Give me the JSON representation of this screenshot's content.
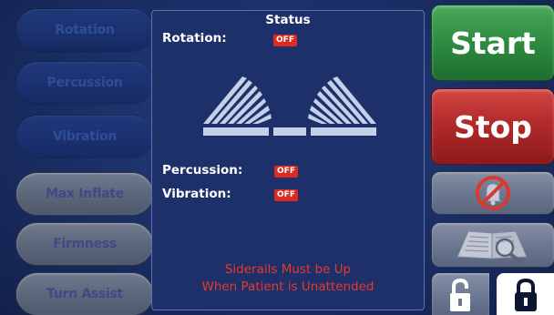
{
  "left_buttons": [
    {
      "label": "Rotation"
    },
    {
      "label": "Percussion"
    },
    {
      "label": "Vibration"
    },
    {
      "label": "Max Inflate"
    },
    {
      "label": "Firmness"
    },
    {
      "label": "Turn Assist"
    }
  ],
  "status_panel": {
    "title": "Status",
    "rotation_label": "Rotation:",
    "rotation_value": "OFF",
    "percussion_label": "Percussion:",
    "percussion_value": "OFF",
    "vibration_label": "Vibration:",
    "vibration_value": "OFF",
    "warning_line1": "Siderails Must be Up",
    "warning_line2": "When Patient is Unattended"
  },
  "right_buttons": {
    "start_label": "Start",
    "stop_label": "Stop",
    "alarm_mute_icon": "silenced-bell-icon",
    "manual_icon": "manual-magnifier-icon",
    "unlock_icon": "unlocked-padlock-icon",
    "lock_icon": "locked-padlock-icon"
  },
  "colors": {
    "background": "#1a2e64",
    "start": "#2f8e42",
    "stop": "#b32a2a",
    "off_badge": "#dc2a20",
    "warning_text": "#e8382c"
  }
}
